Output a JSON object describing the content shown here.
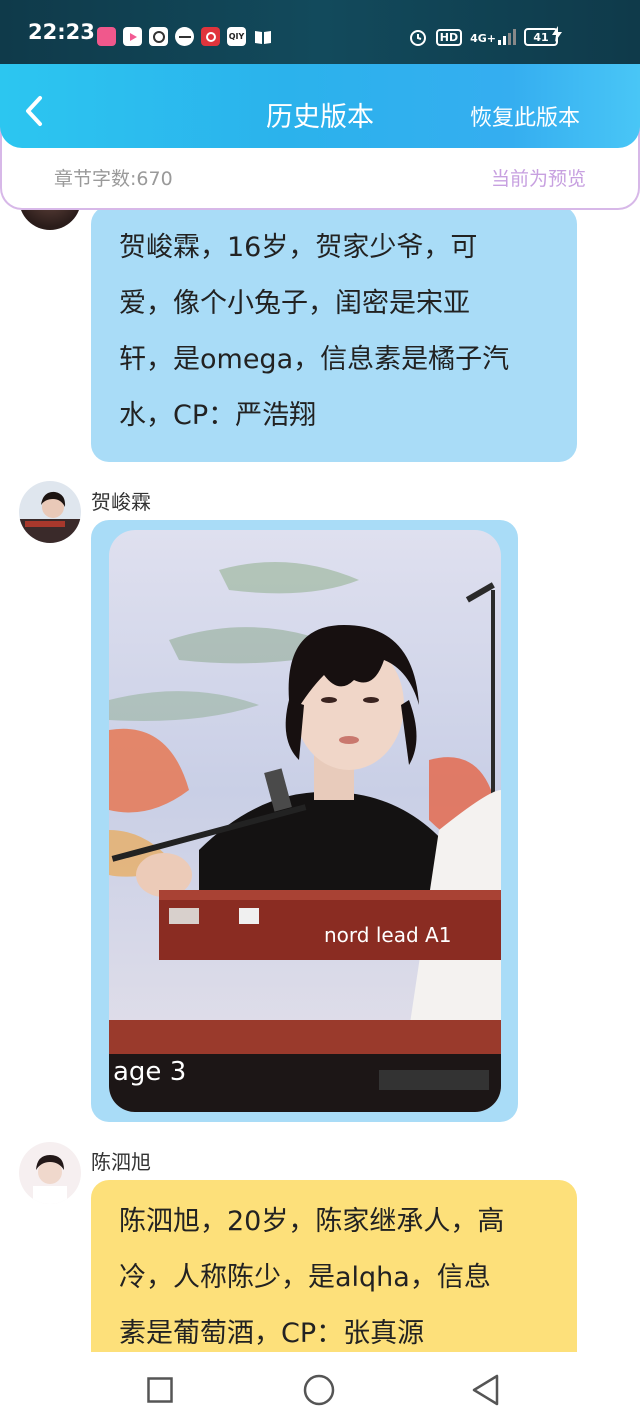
{
  "status_bar": {
    "time": "22:23",
    "app_icons": [
      "app-icon-1",
      "app-icon-2",
      "app-icon-3",
      "app-icon-4",
      "app-icon-5",
      "iqiyi-icon",
      "book-icon"
    ],
    "iqiyi_label": "QIY",
    "hd_label": "HD",
    "network_label": "4G+",
    "battery_level": "41"
  },
  "header": {
    "title": "历史版本",
    "restore_label": "恢复此版本"
  },
  "info": {
    "word_count": "章节字数:670",
    "preview_note": "当前为预览"
  },
  "messages": [
    {
      "speaker": "",
      "text_lines": [
        "贺峻霖，16岁，贺家少爷，可",
        "爱，像个小兔子，闺密是宋亚",
        "轩，是omega，信息素是橘子汽",
        "水，CP：严浩翔"
      ],
      "color": "#a9dcf7"
    },
    {
      "speaker": "贺峻霖",
      "type": "image",
      "image_text": "nord lead A1",
      "image_text_2": "age 3"
    },
    {
      "speaker": "陈泗旭",
      "text_lines": [
        "陈泗旭，20岁，陈家继承人，高",
        "冷，人称陈少，是alqha，信息",
        "素是葡萄酒，CP：张真源"
      ],
      "color": "#fde07a"
    }
  ],
  "colors": {
    "header_start": "#2cc6f0",
    "header_end": "#49c6f6",
    "bubble_blue": "#a9dcf7",
    "bubble_yellow": "#fde07a",
    "preview_purple": "#c7a0e0"
  },
  "nav": [
    "recent-apps-button",
    "home-button",
    "back-nav-button"
  ]
}
